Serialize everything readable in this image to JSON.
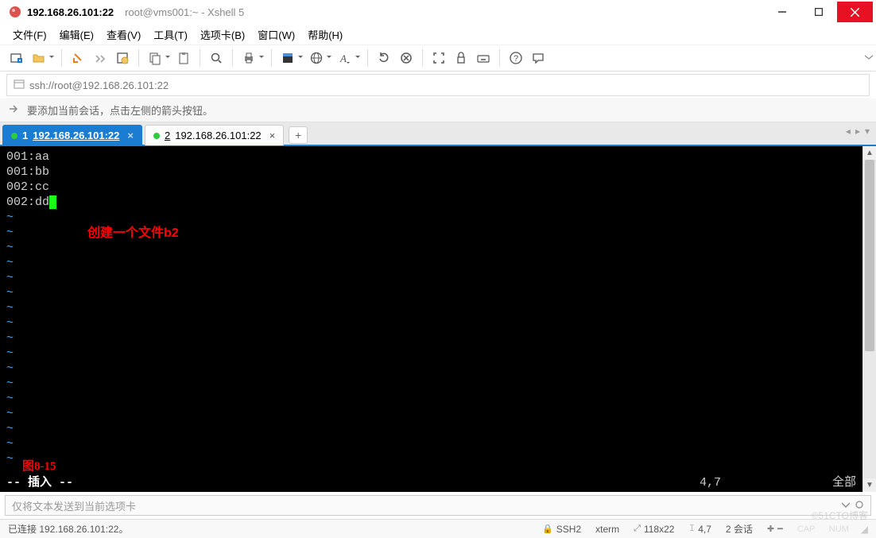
{
  "titlebar": {
    "main": "192.168.26.101:22",
    "sub": "root@vms001:~ - Xshell 5"
  },
  "menu": {
    "file": "文件(F)",
    "edit": "编辑(E)",
    "view": "查看(V)",
    "tools": "工具(T)",
    "tabs": "选项卡(B)",
    "window": "窗口(W)",
    "help": "帮助(H)"
  },
  "addressbar": {
    "url": "ssh://root@192.168.26.101:22"
  },
  "hintbar": {
    "text": "要添加当前会话，点击左侧的箭头按钮。"
  },
  "tabs": [
    {
      "index": "1",
      "label": "192.168.26.101:22"
    },
    {
      "index": "2",
      "label": "192.168.26.101:22"
    }
  ],
  "terminal": {
    "lines": [
      "001:aa",
      "001:bb",
      "002:cc",
      "002:dd"
    ],
    "annotation": "创建一个文件b2",
    "figure": "图8-15",
    "status_mode": "-- 插入 --",
    "status_pos": "4,7",
    "status_scope": "全部"
  },
  "sendbar": {
    "placeholder": "仅将文本发送到当前选项卡"
  },
  "statusbar": {
    "conn": "已连接 192.168.26.101:22。",
    "proto": "SSH2",
    "term": "xterm",
    "size": "118x22",
    "cursor": "4,7",
    "sessions": "2 会话"
  },
  "watermark": "©51CTO博客"
}
